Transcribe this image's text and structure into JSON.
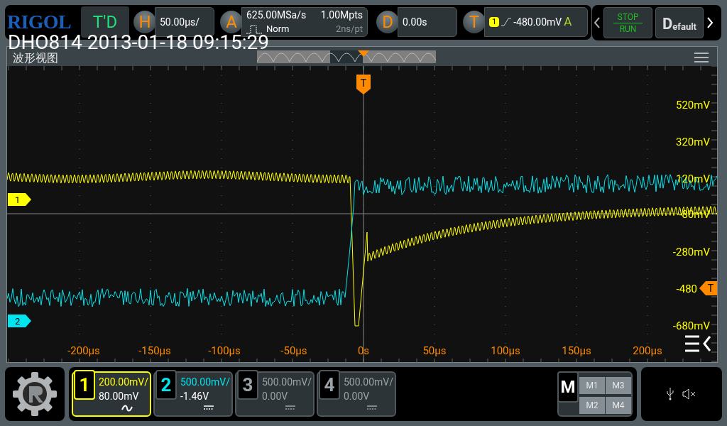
{
  "top_bar": {
    "logo": "RIGOL",
    "mode": "T'D",
    "horizontal": {
      "key": "H",
      "value": "50.00µs/"
    },
    "acquisition": {
      "key": "A",
      "sample_rate": "625.00MSa/s",
      "mode": "Norm",
      "depth": "1.00Mpts",
      "resolution": "2ns/pt"
    },
    "delay": {
      "key": "D",
      "value": "0.00s"
    },
    "trigger": {
      "key": "T",
      "source": "1",
      "level": "-480.00mV",
      "sweep": "A"
    },
    "run_control": {
      "stop": "STOP",
      "run": "RUN"
    },
    "default_button": {
      "initial": "D",
      "rest": "efault"
    }
  },
  "overlay_title": "DHO814 2013-01-18 09:15:29",
  "waveform_view": {
    "title": "波形视图",
    "y_labels": [
      "520mV",
      "320mV",
      "120mV",
      "-80mV",
      "-280mV",
      "-480",
      "-680mV"
    ],
    "x_labels": [
      "-200µs",
      "-150µs",
      "-100µs",
      "-50µs",
      "0s",
      "50µs",
      "100µs",
      "150µs",
      "200µs"
    ],
    "channel_markers": [
      {
        "label": "1",
        "color": "#ffff00"
      },
      {
        "label": "2",
        "color": "#00e5ee"
      }
    ],
    "trigger_markers": [
      "T",
      "T"
    ]
  },
  "channels": [
    {
      "number": "1",
      "scale": "200.00mV/",
      "offset": "80.00mV",
      "kind": "ac",
      "on": true,
      "selected": true
    },
    {
      "number": "2",
      "scale": "500.00mV/",
      "offset": "-1.46V",
      "kind": "dc",
      "on": true,
      "selected": false
    },
    {
      "number": "3",
      "scale": "500.00mV/",
      "offset": "0.00V",
      "kind": "dc",
      "on": false,
      "selected": false
    },
    {
      "number": "4",
      "scale": "500.00mV/",
      "offset": "0.00V",
      "kind": "dc",
      "on": false,
      "selected": false
    }
  ],
  "math": {
    "label": "M",
    "items": [
      "M1",
      "M3",
      "M2",
      "M4"
    ]
  }
}
